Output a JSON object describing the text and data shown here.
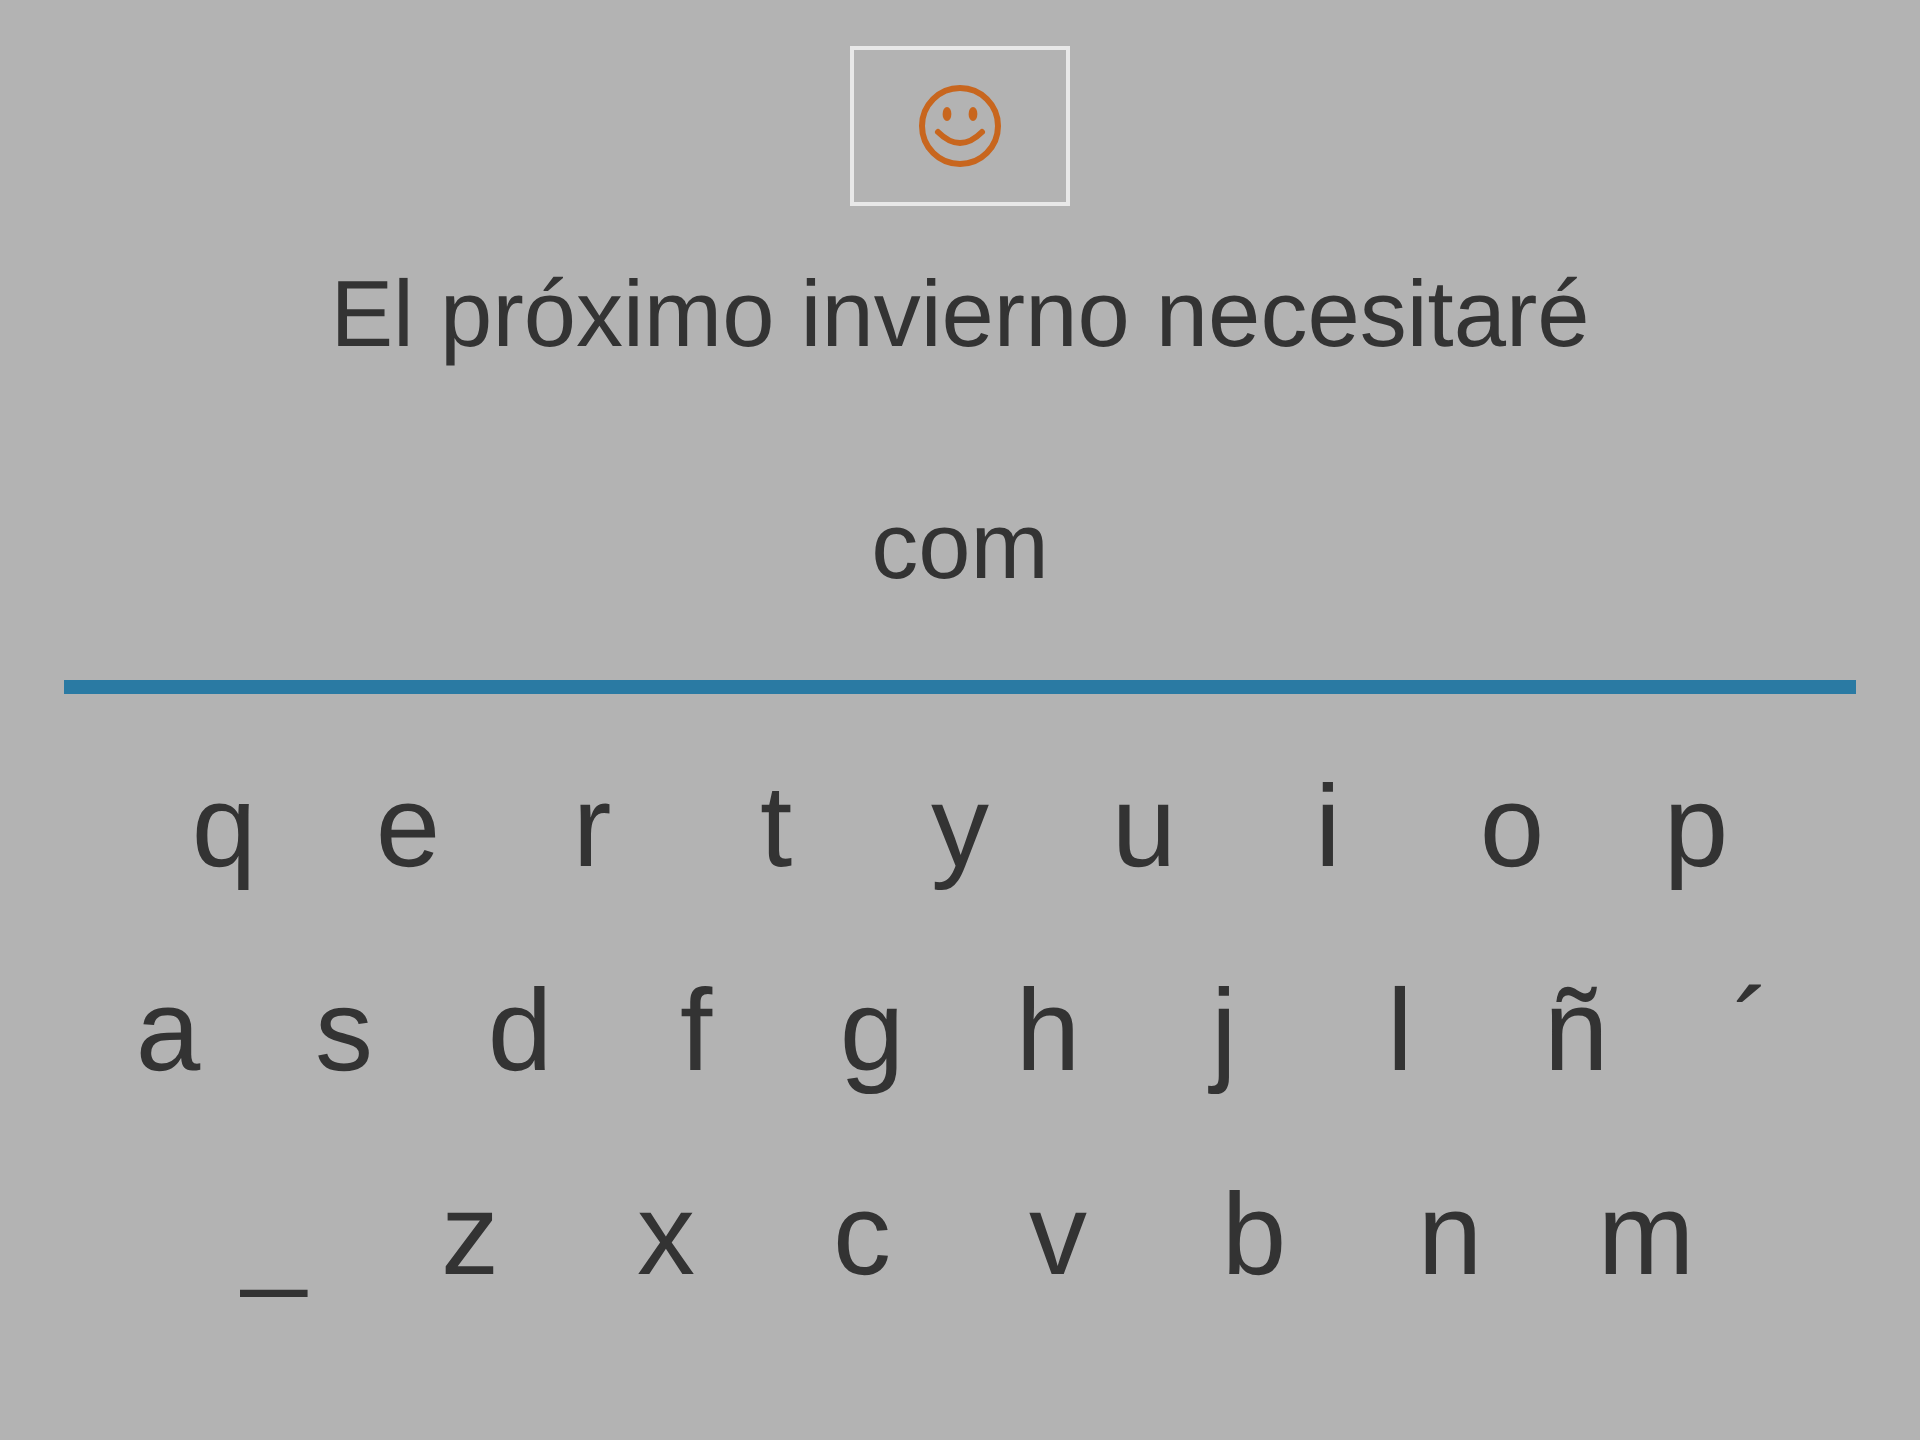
{
  "feedback": {
    "kind": "smiley"
  },
  "sentence": "El próximo invierno necesitaré",
  "answer": "com",
  "keyboard": [
    [
      "q",
      "e",
      "r",
      "t",
      "y",
      "u",
      "i",
      "o",
      "p"
    ],
    [
      "a",
      "s",
      "d",
      "f",
      "g",
      "h",
      "j",
      "l",
      "ñ",
      "´"
    ],
    [
      "_",
      "z",
      "x",
      "c",
      "v",
      "b",
      "n",
      "m"
    ]
  ]
}
